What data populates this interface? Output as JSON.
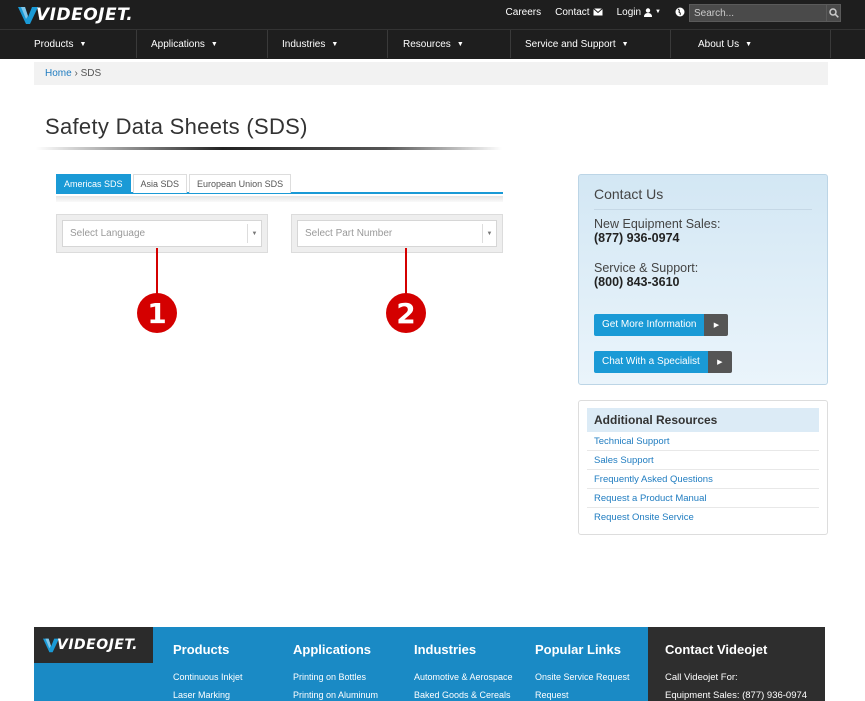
{
  "header": {
    "logo_text": "VIDEOJET.",
    "links": [
      "Careers",
      "Contact",
      "Login"
    ],
    "search_placeholder": "Search...",
    "nav": [
      "Products",
      "Applications",
      "Industries",
      "Resources",
      "Service and Support",
      "About Us"
    ]
  },
  "breadcrumb": {
    "home": "Home",
    "separator": "›",
    "current": "SDS"
  },
  "page_title": "Safety Data Sheets (SDS)",
  "tabs": [
    "Americas SDS",
    "Asia SDS",
    "European Union SDS"
  ],
  "selects": {
    "language_placeholder": "Select Language",
    "part_placeholder": "Select Part Number"
  },
  "callouts": [
    "1",
    "2"
  ],
  "contact": {
    "title": "Contact Us",
    "equipment_label": "New Equipment Sales:",
    "equipment_phone": "(877) 936-0974",
    "service_label": "Service & Support:",
    "service_phone": "(800) 843-3610",
    "btn_info": "Get More Information",
    "btn_chat": "Chat With a Specialist"
  },
  "resources": {
    "title": "Additional Resources",
    "links": [
      "Technical Support",
      "Sales Support",
      "Frequently Asked Questions",
      "Request a Product Manual",
      "Request Onsite Service"
    ]
  },
  "footer": {
    "logo_text": "VIDEOJET.",
    "products": {
      "title": "Products",
      "items": [
        "Continuous Inkjet",
        "Laser Marking"
      ]
    },
    "applications": {
      "title": "Applications",
      "items": [
        "Printing on Bottles",
        "Printing on Aluminum"
      ]
    },
    "industries": {
      "title": "Industries",
      "items": [
        "Automotive & Aerospace",
        "Baked Goods & Cereals"
      ]
    },
    "popular": {
      "title": "Popular Links",
      "items": [
        "Onsite Service Request",
        "Request"
      ]
    },
    "contact": {
      "title": "Contact Videojet",
      "line1": "Call Videojet For:",
      "line2": "Equipment Sales: (877) 936-0974"
    }
  },
  "colors": {
    "accent": "#1a9ad6",
    "dark": "#1e1e1e",
    "callout": "#d40000"
  }
}
